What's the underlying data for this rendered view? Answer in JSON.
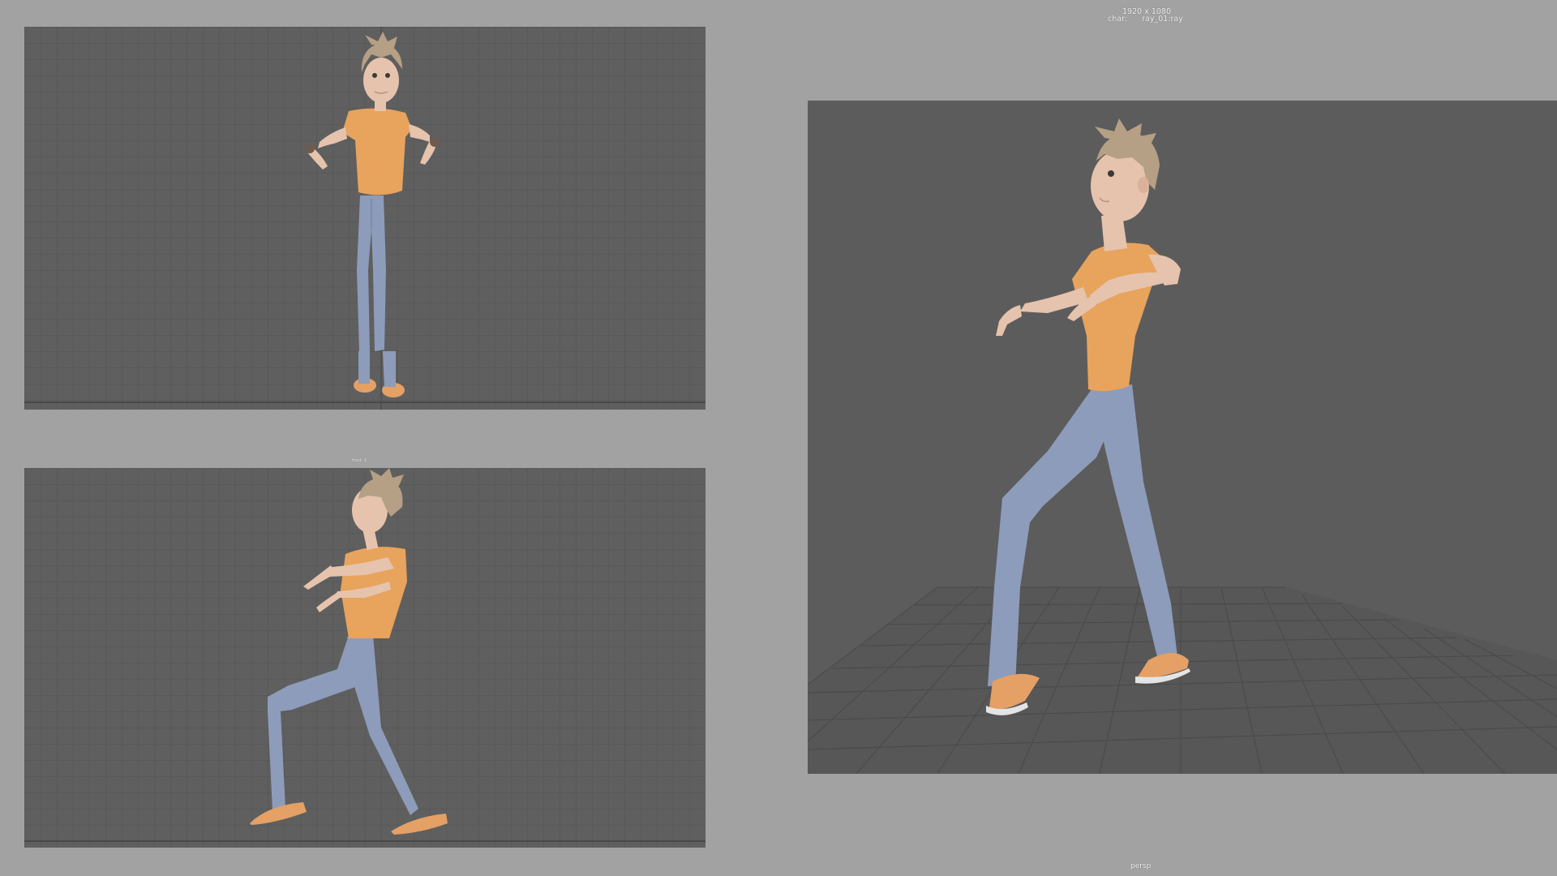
{
  "hud": {
    "resolution": "1920 x 1080",
    "char_label": "char:",
    "char_value": "ray_01:ray",
    "front_cam_label": "front -1",
    "persp_label": "persp"
  },
  "colors": {
    "background": "#a2a2a2",
    "viewport_bg": "#5f5f5f",
    "grid_line": "#525252",
    "shirt": "#e8a35c",
    "pants": "#8d9cba",
    "skin": "#e6c3ad",
    "hair": "#b59f85",
    "shoes": "#e5a066"
  },
  "viewports": {
    "top": {
      "name": "viewport-ortho-top"
    },
    "front": {
      "name": "viewport-ortho-side"
    },
    "persp": {
      "name": "viewport-perspective"
    }
  }
}
